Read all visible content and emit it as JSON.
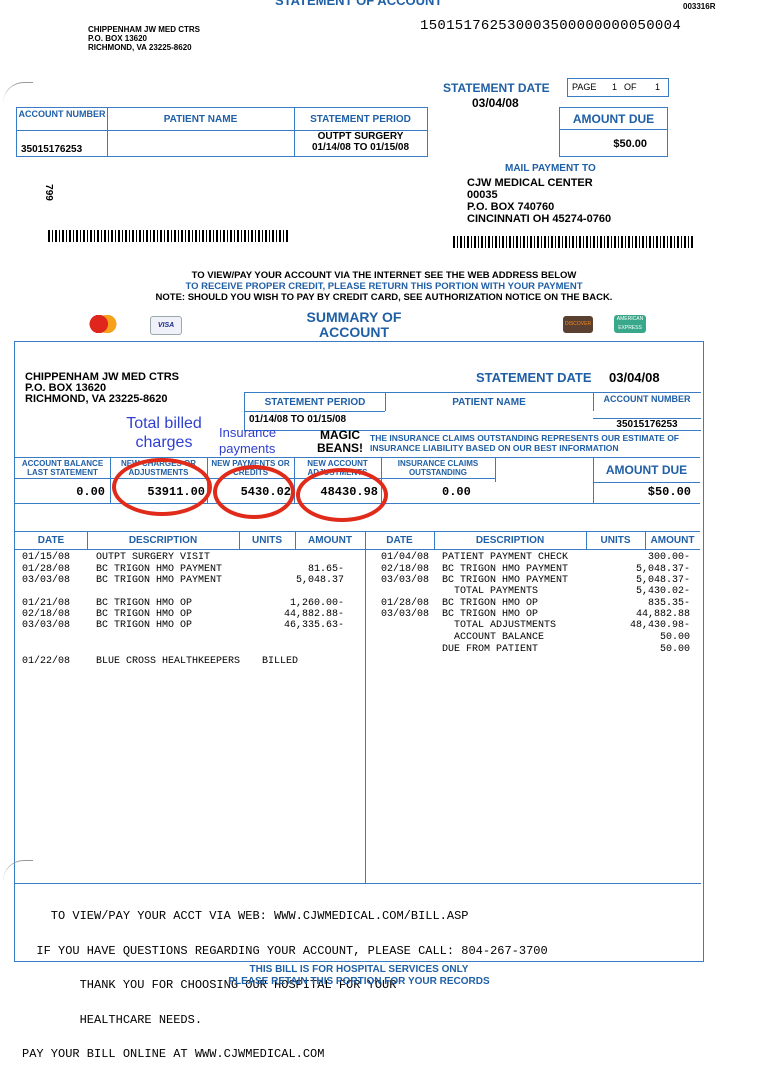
{
  "top": {
    "title": "STATEMENT OF ACCOUNT",
    "code": "003316R",
    "hospital_name": "CHIPPENHAM JW MED CTRS",
    "po_box": "P.O. BOX 13620",
    "city": "RICHMOND, VA 23225-8620",
    "scanline": "150151762530003500000000050004"
  },
  "remit": {
    "statement_date_label": "STATEMENT DATE",
    "statement_date": "03/04/08",
    "page_label": "PAGE",
    "page_num": "1",
    "page_of": "OF",
    "page_total": "1",
    "amount_due_label": "AMOUNT DUE",
    "amount_due": "$50.00",
    "account_number_label": "ACCOUNT NUMBER",
    "account_number": "35015176253",
    "patient_name_label": "PATIENT NAME",
    "statement_period_label": "STATEMENT PERIOD",
    "period_type": "OUTPT SURGERY",
    "period": "01/14/08 TO 01/15/08",
    "mail_to_label": "MAIL PAYMENT TO",
    "mail_lines": [
      "CJW MEDICAL CENTER",
      "00035",
      "P.O. BOX 740760",
      "CINCINNATI OH 45274-0760"
    ],
    "side_num": "799"
  },
  "instructions": {
    "line1": "TO VIEW/PAY YOUR ACCOUNT VIA THE INTERNET SEE THE WEB ADDRESS BELOW",
    "line2": "TO RECEIVE PROPER CREDIT, PLEASE RETURN THIS PORTION WITH YOUR PAYMENT",
    "line3": "NOTE: SHOULD YOU WISH TO PAY BY CREDIT CARD, SEE AUTHORIZATION NOTICE ON THE BACK."
  },
  "summary": {
    "title1": "SUMMARY OF",
    "title2": "ACCOUNT",
    "hospital_name": "CHIPPENHAM JW MED CTRS",
    "po_box": "P.O. BOX 13620",
    "city": "RICHMOND, VA 23225-8620",
    "statement_date_label": "STATEMENT DATE",
    "statement_date": "03/04/08",
    "statement_period_label": "STATEMENT PERIOD",
    "period": "01/14/08 TO 01/15/08",
    "patient_name_label": "PATIENT NAME",
    "account_number_label": "ACCOUNT NUMBER",
    "account_number": "35015176253",
    "magic_beans": "MAGIC BEANS!",
    "insurance_note": "THE INSURANCE CLAIMS OUTSTANDING REPRESENTS OUR ESTIMATE OF INSURANCE LIABILITY BASED ON OUR BEST INFORMATION",
    "col_balance": "ACCOUNT BALANCE LAST STATEMENT",
    "col_charges": "NEW CHARGES OR ADJUSTMENTS",
    "col_payments": "NEW PAYMENTS OR CREDITS",
    "col_adjustments": "NEW ACCOUNT ADJUSTMENTS",
    "col_claims": "INSURANCE CLAIMS OUTSTANDING",
    "col_amount_due": "AMOUNT DUE",
    "balance": "0.00",
    "charges": "53911.00",
    "payments": "5430.02",
    "adjustments": "48430.98",
    "claims": "0.00",
    "amount_due": "$50.00",
    "note_charges": "Total billed charges",
    "note_payments": "Insurance payments"
  },
  "detail": {
    "headers": {
      "date": "DATE",
      "description": "DESCRIPTION",
      "units": "UNITS",
      "amount": "AMOUNT"
    },
    "left": [
      {
        "date": "01/15/08",
        "desc": "OUTPT SURGERY VISIT",
        "amount": ""
      },
      {
        "date": "01/28/08",
        "desc": "BC TRIGON HMO PAYMENT",
        "amount": "81.65-"
      },
      {
        "date": "03/03/08",
        "desc": "BC TRIGON HMO PAYMENT",
        "amount": "5,048.37"
      },
      {
        "date": "01/21/08",
        "desc": "BC TRIGON HMO OP",
        "amount": "1,260.00-"
      },
      {
        "date": "02/18/08",
        "desc": "BC TRIGON HMO OP",
        "amount": "44,882.88-"
      },
      {
        "date": "03/03/08",
        "desc": "BC TRIGON HMO OP",
        "amount": "46,335.63-"
      }
    ],
    "billed": {
      "date": "01/22/08",
      "desc": "BLUE CROSS HEALTHKEEPERS",
      "status": "BILLED"
    },
    "right": [
      {
        "date": "01/04/08",
        "desc": "PATIENT PAYMENT CHECK",
        "amount": "300.00-"
      },
      {
        "date": "02/18/08",
        "desc": "BC TRIGON HMO PAYMENT",
        "amount": "5,048.37-"
      },
      {
        "date": "03/03/08",
        "desc": "BC TRIGON HMO PAYMENT",
        "amount": "5,048.37-"
      },
      {
        "date": "",
        "desc": "TOTAL PAYMENTS",
        "amount": "5,430.02-"
      },
      {
        "date": "01/28/08",
        "desc": "BC TRIGON HMO OP",
        "amount": "835.35-"
      },
      {
        "date": "03/03/08",
        "desc": "BC TRIGON HMO OP",
        "amount": "44,882.88"
      },
      {
        "date": "",
        "desc": "TOTAL ADJUSTMENTS",
        "amount": "48,430.98-"
      },
      {
        "date": "",
        "desc": "ACCOUNT BALANCE",
        "amount": "50.00"
      },
      {
        "date": "",
        "desc": "DUE FROM PATIENT",
        "amount": "50.00"
      }
    ]
  },
  "footer_msg": [
    "    TO VIEW/PAY YOUR ACCT VIA WEB: WWW.CJWMEDICAL.COM/BILL.ASP",
    "  IF YOU HAVE QUESTIONS REGARDING YOUR ACCOUNT, PLEASE CALL: 804-267-3700",
    "        THANK YOU FOR CHOOSING OUR HOSPITAL FOR YOUR",
    "        HEALTHCARE NEEDS.",
    "PAY YOUR BILL ONLINE AT WWW.CJWMEDICAL.COM"
  ],
  "bottom": {
    "line1": "THIS BILL IS FOR HOSPITAL SERVICES ONLY",
    "line2": "PLEASE RETAIN THIS PORTION FOR YOUR RECORDS"
  },
  "cards": {
    "mastercard": "MasterCard",
    "visa": "VISA",
    "discover": "DISCOVER",
    "amex": "AMERICAN EXPRESS"
  },
  "colors": {
    "accent": "#1f5fa6",
    "annotation_red": "#e02a1a",
    "annotation_blue": "#2f3fd0"
  }
}
